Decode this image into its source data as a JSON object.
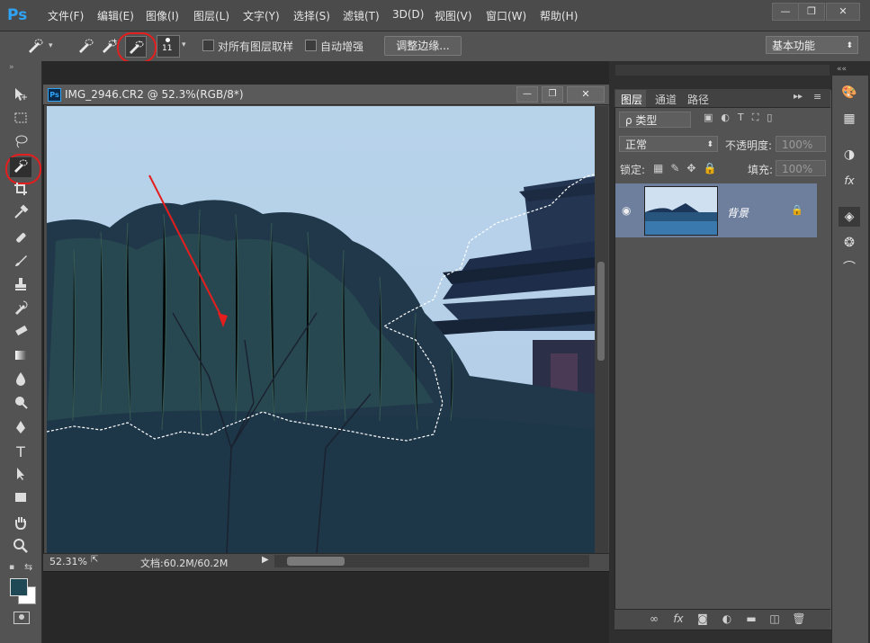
{
  "app": {
    "logo": "Ps"
  },
  "menu": [
    "文件(F)",
    "编辑(E)",
    "图像(I)",
    "图层(L)",
    "文字(Y)",
    "选择(S)",
    "滤镜(T)",
    "3D(D)",
    "视图(V)",
    "窗口(W)",
    "帮助(H)"
  ],
  "window_controls": {
    "minimize": "—",
    "restore": "❐",
    "close": "✕"
  },
  "options": {
    "brush_size": "11",
    "sample_all_layers": "对所有图层取样",
    "auto_enhance": "自动增强",
    "refine_edge": "调整边缘...",
    "workspace": "基本功能"
  },
  "document": {
    "title": "IMG_2946.CR2 @ 52.3%(RGB/8*)",
    "zoom": "52.31%",
    "doc_size": "文档:60.2M/60.2M"
  },
  "layers_panel": {
    "tabs": [
      "图层",
      "通道",
      "路径"
    ],
    "filter_label": "ρ 类型",
    "blend_mode": "正常",
    "opacity_label": "不透明度:",
    "opacity_value": "100%",
    "lock_label": "锁定:",
    "fill_label": "填充:",
    "fill_value": "100%",
    "layer_name": "背景"
  },
  "colors": {
    "accent": "#2fa3f6",
    "highlight_red": "#e41e1e",
    "layer_selected": "#6e7f9e",
    "foreground": "#1f4a55",
    "background": "#ffffff"
  }
}
